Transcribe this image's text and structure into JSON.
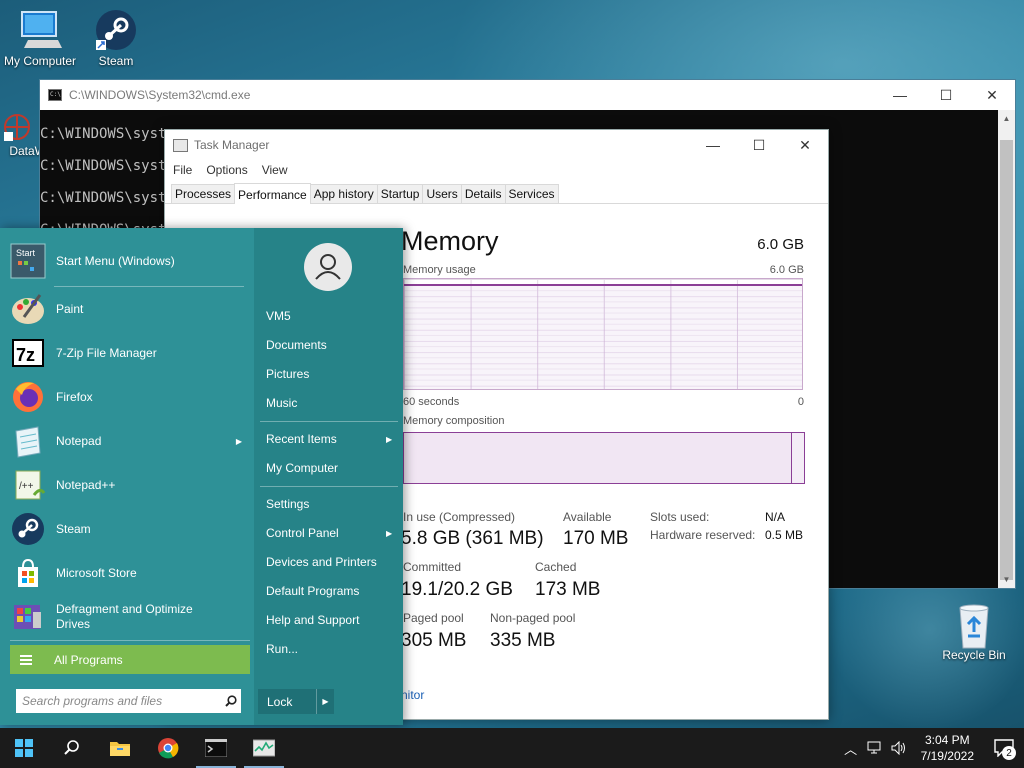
{
  "desktop": {
    "icons": [
      {
        "label": "My Computer"
      },
      {
        "label": "Steam"
      },
      {
        "label": "DataWC"
      },
      {
        "label": "Recycle Bin"
      }
    ]
  },
  "cmd": {
    "title": "C:\\WINDOWS\\System32\\cmd.exe",
    "lines": [
      "C:\\WINDOWS\\syste",
      "C:\\WINDOWS\\syste",
      "C:\\WINDOWS\\syste",
      "C:\\WINDOWS\\syste"
    ]
  },
  "window_controls": {
    "minimize": "—",
    "maximize": "☐",
    "close": "✕"
  },
  "task_manager": {
    "title": "Task Manager",
    "menu": [
      "File",
      "Options",
      "View"
    ],
    "tabs": [
      "Processes",
      "Performance",
      "App history",
      "Startup",
      "Users",
      "Details",
      "Services"
    ],
    "active_tab": "Performance",
    "memory": {
      "heading": "Memory",
      "total": "6.0 GB",
      "usage_label": "Memory usage",
      "usage_max": "6.0 GB",
      "axis_left": "60 seconds",
      "axis_right": "0",
      "composition_label": "Memory composition",
      "usage_fraction": 0.97,
      "stats": {
        "in_use_label": "In use (Compressed)",
        "in_use_value": "5.8 GB (361 MB)",
        "available_label": "Available",
        "available_value": "170 MB",
        "committed_label": "Committed",
        "committed_value": "19.1/20.2 GB",
        "cached_label": "Cached",
        "cached_value": "173 MB",
        "paged_label": "Paged pool",
        "paged_value": "305 MB",
        "nonpaged_label": "Non-paged pool",
        "nonpaged_value": "335 MB",
        "slots_label": "Slots used:",
        "slots_value": "N/A",
        "hw_reserved_label": "Hardware reserved:",
        "hw_reserved_value": "0.5 MB"
      },
      "monitor_link": "nitor"
    }
  },
  "start_menu": {
    "header_item": "Start Menu (Windows)",
    "programs": [
      {
        "label": "Paint",
        "has_arrow": false
      },
      {
        "label": "7-Zip File Manager",
        "has_arrow": false
      },
      {
        "label": "Firefox",
        "has_arrow": false
      },
      {
        "label": "Notepad",
        "has_arrow": true
      },
      {
        "label": "Notepad++",
        "has_arrow": false
      },
      {
        "label": "Steam",
        "has_arrow": false
      },
      {
        "label": "Microsoft Store",
        "has_arrow": false
      },
      {
        "label": "Defragment and Optimize Drives",
        "has_arrow": false
      }
    ],
    "all_programs": "All Programs",
    "search_placeholder": "Search programs and files",
    "right_items": {
      "user": "VM5",
      "documents": "Documents",
      "pictures": "Pictures",
      "music": "Music",
      "recent": "Recent Items",
      "computer": "My Computer",
      "settings": "Settings",
      "control_panel": "Control Panel",
      "devices": "Devices and Printers",
      "default_programs": "Default Programs",
      "help": "Help and Support",
      "run": "Run..."
    },
    "lock": "Lock"
  },
  "taskbar": {
    "time": "3:04 PM",
    "date": "7/19/2022",
    "notification_count": "2"
  },
  "colors": {
    "start_bg": "#2e9197",
    "all_programs": "#7dbb4f",
    "memory_accent": "#8b3f96",
    "taskbar": "#1b1b1b"
  }
}
